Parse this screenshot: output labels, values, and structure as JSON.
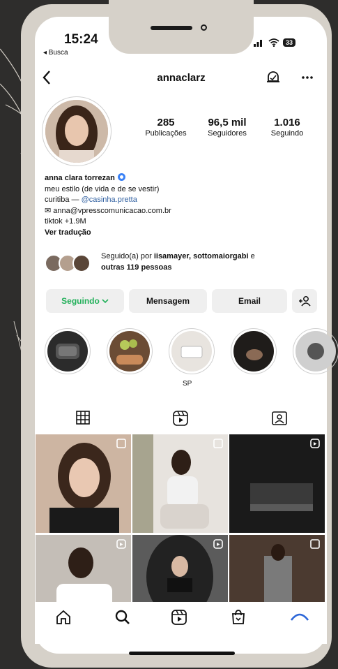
{
  "status_bar": {
    "time": "15:24",
    "back_app": "◂ Busca",
    "battery": "33"
  },
  "header": {
    "username": "annaclarz"
  },
  "stats": [
    {
      "value": "285",
      "label": "Publicações"
    },
    {
      "value": "96,5 mil",
      "label": "Seguidores"
    },
    {
      "value": "1.016",
      "label": "Seguindo"
    }
  ],
  "bio": {
    "name": "anna clara torrezan",
    "line1": "meu estilo (de vida e de se vestir)",
    "city": "curitiba — ",
    "city_link": "@casinha.pretta",
    "email": "✉ anna@vpresscomunicacao.com.br",
    "tiktok": "tiktok +1.9M",
    "translate": "Ver tradução"
  },
  "followed_by": {
    "prefix": "Seguido(a) por ",
    "names": "iisamayer, sottomaiorgabi",
    "joiner": " e",
    "others": "outras 119 pessoas"
  },
  "buttons": {
    "following": "Seguindo",
    "message": "Mensagem",
    "email": "Email",
    "add_user": "+ᴿ"
  },
  "highlights": [
    {
      "label": ""
    },
    {
      "label": ""
    },
    {
      "label": "SP"
    },
    {
      "label": ""
    },
    {
      "label": ""
    }
  ],
  "tabs": [
    "grid-tab",
    "reels-tab",
    "tagged-tab"
  ],
  "colors": {
    "accent_green": "#22b05a",
    "link_blue": "#2f5fa0",
    "verified_blue": "#3b82f6",
    "frame": "#d6d1c9",
    "background": "#2e2d2c"
  }
}
